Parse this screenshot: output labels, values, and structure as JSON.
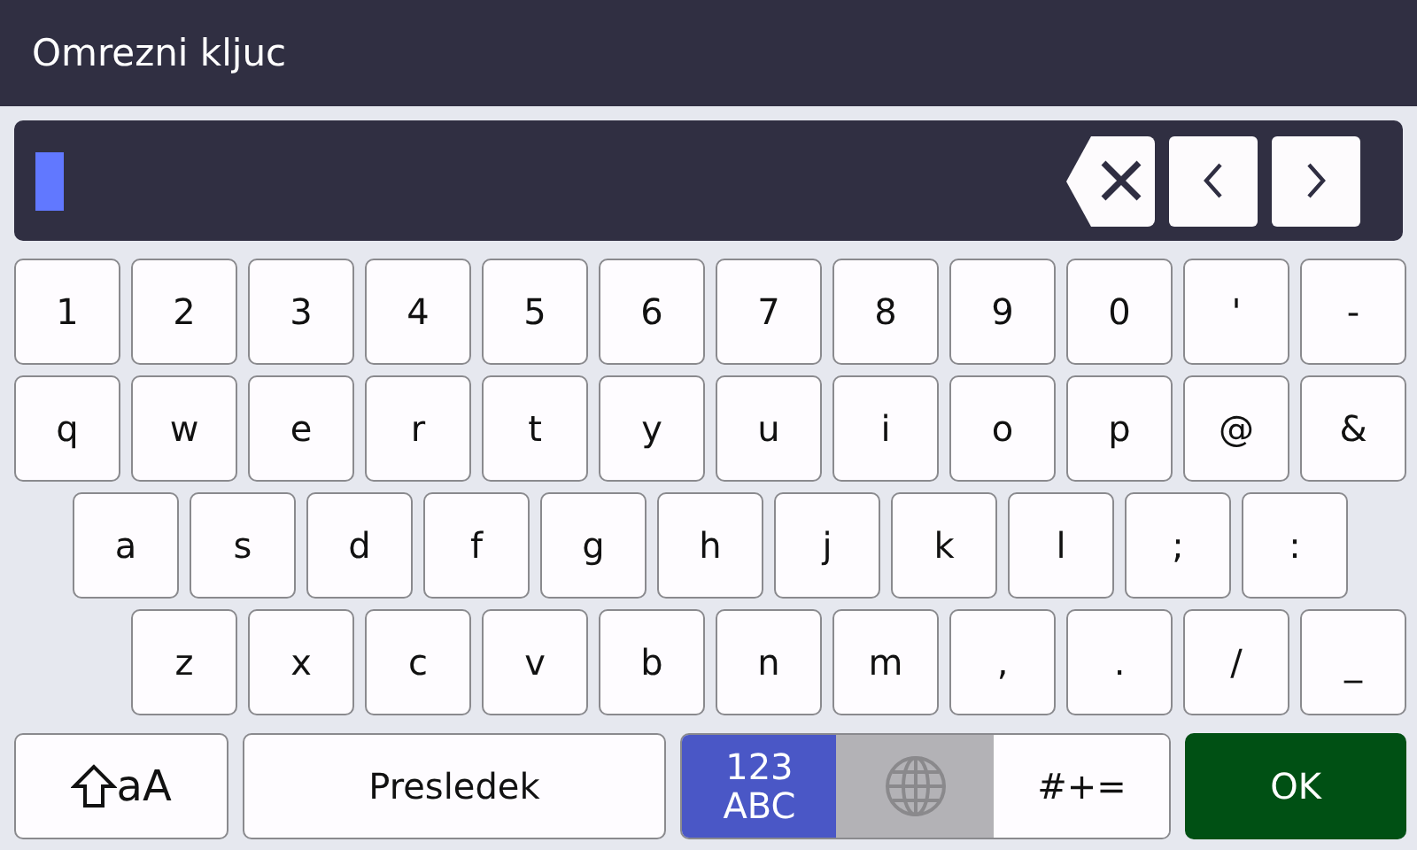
{
  "header": {
    "title": "Omrezni kljuc"
  },
  "input": {
    "cursor": true
  },
  "key_rows": [
    [
      "1",
      "2",
      "3",
      "4",
      "5",
      "6",
      "7",
      "8",
      "9",
      "0",
      "'",
      "-"
    ],
    [
      "q",
      "w",
      "e",
      "r",
      "t",
      "y",
      "u",
      "i",
      "o",
      "p",
      "@",
      "&"
    ],
    [
      "a",
      "s",
      "d",
      "f",
      "g",
      "h",
      "j",
      "k",
      "l",
      ";",
      ":"
    ],
    [
      "z",
      "x",
      "c",
      "v",
      "b",
      "n",
      "m",
      ",",
      ".",
      "/",
      "_"
    ]
  ],
  "bottom": {
    "shift": {
      "label": "aA"
    },
    "space": {
      "label": "Presledek"
    },
    "modes": [
      {
        "kind": "text",
        "lines": [
          "123",
          "ABC"
        ],
        "selected": true,
        "disabled": false
      },
      {
        "kind": "globe",
        "selected": false,
        "disabled": true
      },
      {
        "kind": "text",
        "lines": [
          "#+="
        ],
        "selected": false,
        "disabled": false
      }
    ],
    "ok": {
      "label": "OK"
    }
  }
}
